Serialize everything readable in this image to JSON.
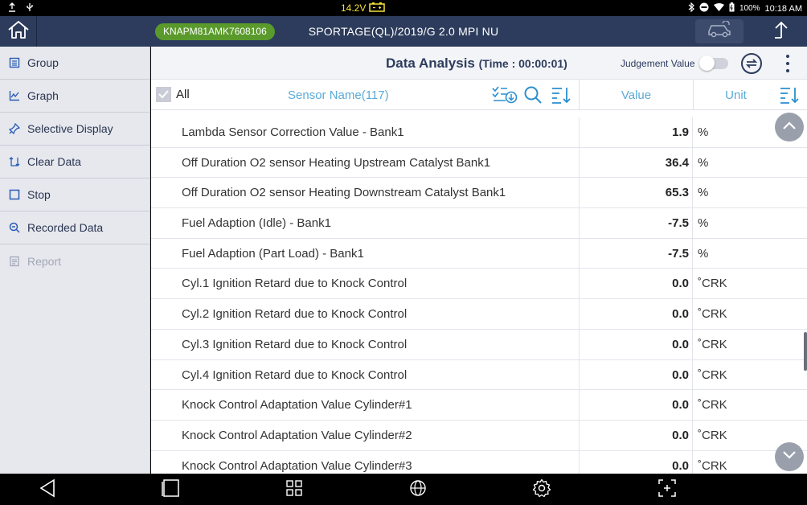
{
  "status_bar": {
    "voltage": "14.2V",
    "battery_pct": "100%",
    "time": "10:18 AM"
  },
  "title_bar": {
    "vin": "KNAPM81AMK7608106",
    "vehicle": "SPORTAGE(QL)/2019/G 2.0 MPI NU"
  },
  "sidebar": {
    "items": [
      {
        "label": "Group",
        "icon": "group-icon"
      },
      {
        "label": "Graph",
        "icon": "graph-icon"
      },
      {
        "label": "Selective Display",
        "icon": "pin-icon"
      },
      {
        "label": "Clear Data",
        "icon": "clear-data-icon"
      },
      {
        "label": "Stop",
        "icon": "stop-icon"
      },
      {
        "label": "Recorded Data",
        "icon": "recorded-data-icon"
      },
      {
        "label": "Report",
        "icon": "report-icon"
      }
    ]
  },
  "header": {
    "title": "Data Analysis",
    "time": "(Time : 00:00:01)",
    "judgement_label": "Judgement Value"
  },
  "columns": {
    "all": "All",
    "sensor": "Sensor Name(117)",
    "value": "Value",
    "unit": "Unit"
  },
  "rows": [
    {
      "name": "Lambda Sensor Correction Value - Bank1",
      "value": "1.9",
      "unit": "%"
    },
    {
      "name": "Off Duration O2 sensor Heating Upstream Catalyst Bank1",
      "value": "36.4",
      "unit": "%"
    },
    {
      "name": "Off Duration O2 sensor Heating Downstream Catalyst Bank1",
      "value": "65.3",
      "unit": "%"
    },
    {
      "name": "Fuel Adaption (Idle) - Bank1",
      "value": "-7.5",
      "unit": "%"
    },
    {
      "name": "Fuel Adaption (Part Load) - Bank1",
      "value": "-7.5",
      "unit": "%"
    },
    {
      "name": "Cyl.1 Ignition Retard due to Knock Control",
      "value": "0.0",
      "unit": "˚CRK"
    },
    {
      "name": "Cyl.2 Ignition Retard due to Knock Control",
      "value": "0.0",
      "unit": "˚CRK"
    },
    {
      "name": "Cyl.3 Ignition Retard due to Knock Control",
      "value": "0.0",
      "unit": "˚CRK"
    },
    {
      "name": "Cyl.4 Ignition Retard due to Knock Control",
      "value": "0.0",
      "unit": "˚CRK"
    },
    {
      "name": "Knock Control Adaptation Value Cylinder#1",
      "value": "0.0",
      "unit": "˚CRK"
    },
    {
      "name": "Knock Control Adaptation Value Cylinder#2",
      "value": "0.0",
      "unit": "˚CRK"
    },
    {
      "name": "Knock Control Adaptation Value Cylinder#3",
      "value": "0.0",
      "unit": "˚CRK"
    }
  ],
  "colors": {
    "accent": "#2d3c5c",
    "column_header": "#5aaad6",
    "vin_badge": "#5a9a2c",
    "voltage": "#f5e23a"
  }
}
